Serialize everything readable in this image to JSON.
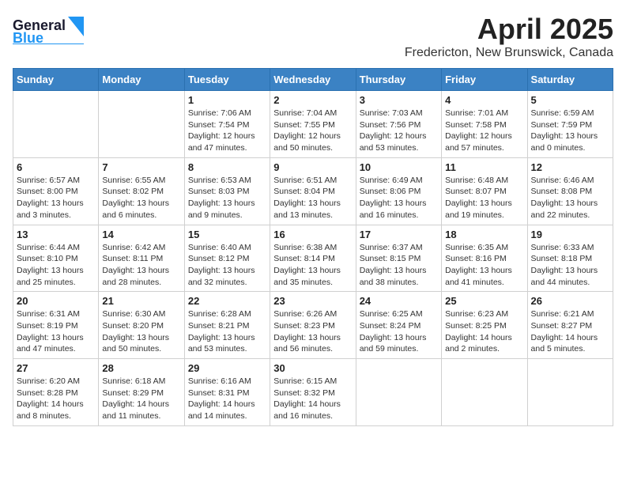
{
  "header": {
    "logo_line1": "General",
    "logo_line2": "Blue",
    "title": "April 2025",
    "subtitle": "Fredericton, New Brunswick, Canada"
  },
  "days_of_week": [
    "Sunday",
    "Monday",
    "Tuesday",
    "Wednesday",
    "Thursday",
    "Friday",
    "Saturday"
  ],
  "weeks": [
    [
      {
        "day": "",
        "info": ""
      },
      {
        "day": "",
        "info": ""
      },
      {
        "day": "1",
        "info": "Sunrise: 7:06 AM\nSunset: 7:54 PM\nDaylight: 12 hours and 47 minutes."
      },
      {
        "day": "2",
        "info": "Sunrise: 7:04 AM\nSunset: 7:55 PM\nDaylight: 12 hours and 50 minutes."
      },
      {
        "day": "3",
        "info": "Sunrise: 7:03 AM\nSunset: 7:56 PM\nDaylight: 12 hours and 53 minutes."
      },
      {
        "day": "4",
        "info": "Sunrise: 7:01 AM\nSunset: 7:58 PM\nDaylight: 12 hours and 57 minutes."
      },
      {
        "day": "5",
        "info": "Sunrise: 6:59 AM\nSunset: 7:59 PM\nDaylight: 13 hours and 0 minutes."
      }
    ],
    [
      {
        "day": "6",
        "info": "Sunrise: 6:57 AM\nSunset: 8:00 PM\nDaylight: 13 hours and 3 minutes."
      },
      {
        "day": "7",
        "info": "Sunrise: 6:55 AM\nSunset: 8:02 PM\nDaylight: 13 hours and 6 minutes."
      },
      {
        "day": "8",
        "info": "Sunrise: 6:53 AM\nSunset: 8:03 PM\nDaylight: 13 hours and 9 minutes."
      },
      {
        "day": "9",
        "info": "Sunrise: 6:51 AM\nSunset: 8:04 PM\nDaylight: 13 hours and 13 minutes."
      },
      {
        "day": "10",
        "info": "Sunrise: 6:49 AM\nSunset: 8:06 PM\nDaylight: 13 hours and 16 minutes."
      },
      {
        "day": "11",
        "info": "Sunrise: 6:48 AM\nSunset: 8:07 PM\nDaylight: 13 hours and 19 minutes."
      },
      {
        "day": "12",
        "info": "Sunrise: 6:46 AM\nSunset: 8:08 PM\nDaylight: 13 hours and 22 minutes."
      }
    ],
    [
      {
        "day": "13",
        "info": "Sunrise: 6:44 AM\nSunset: 8:10 PM\nDaylight: 13 hours and 25 minutes."
      },
      {
        "day": "14",
        "info": "Sunrise: 6:42 AM\nSunset: 8:11 PM\nDaylight: 13 hours and 28 minutes."
      },
      {
        "day": "15",
        "info": "Sunrise: 6:40 AM\nSunset: 8:12 PM\nDaylight: 13 hours and 32 minutes."
      },
      {
        "day": "16",
        "info": "Sunrise: 6:38 AM\nSunset: 8:14 PM\nDaylight: 13 hours and 35 minutes."
      },
      {
        "day": "17",
        "info": "Sunrise: 6:37 AM\nSunset: 8:15 PM\nDaylight: 13 hours and 38 minutes."
      },
      {
        "day": "18",
        "info": "Sunrise: 6:35 AM\nSunset: 8:16 PM\nDaylight: 13 hours and 41 minutes."
      },
      {
        "day": "19",
        "info": "Sunrise: 6:33 AM\nSunset: 8:18 PM\nDaylight: 13 hours and 44 minutes."
      }
    ],
    [
      {
        "day": "20",
        "info": "Sunrise: 6:31 AM\nSunset: 8:19 PM\nDaylight: 13 hours and 47 minutes."
      },
      {
        "day": "21",
        "info": "Sunrise: 6:30 AM\nSunset: 8:20 PM\nDaylight: 13 hours and 50 minutes."
      },
      {
        "day": "22",
        "info": "Sunrise: 6:28 AM\nSunset: 8:21 PM\nDaylight: 13 hours and 53 minutes."
      },
      {
        "day": "23",
        "info": "Sunrise: 6:26 AM\nSunset: 8:23 PM\nDaylight: 13 hours and 56 minutes."
      },
      {
        "day": "24",
        "info": "Sunrise: 6:25 AM\nSunset: 8:24 PM\nDaylight: 13 hours and 59 minutes."
      },
      {
        "day": "25",
        "info": "Sunrise: 6:23 AM\nSunset: 8:25 PM\nDaylight: 14 hours and 2 minutes."
      },
      {
        "day": "26",
        "info": "Sunrise: 6:21 AM\nSunset: 8:27 PM\nDaylight: 14 hours and 5 minutes."
      }
    ],
    [
      {
        "day": "27",
        "info": "Sunrise: 6:20 AM\nSunset: 8:28 PM\nDaylight: 14 hours and 8 minutes."
      },
      {
        "day": "28",
        "info": "Sunrise: 6:18 AM\nSunset: 8:29 PM\nDaylight: 14 hours and 11 minutes."
      },
      {
        "day": "29",
        "info": "Sunrise: 6:16 AM\nSunset: 8:31 PM\nDaylight: 14 hours and 14 minutes."
      },
      {
        "day": "30",
        "info": "Sunrise: 6:15 AM\nSunset: 8:32 PM\nDaylight: 14 hours and 16 minutes."
      },
      {
        "day": "",
        "info": ""
      },
      {
        "day": "",
        "info": ""
      },
      {
        "day": "",
        "info": ""
      }
    ]
  ]
}
